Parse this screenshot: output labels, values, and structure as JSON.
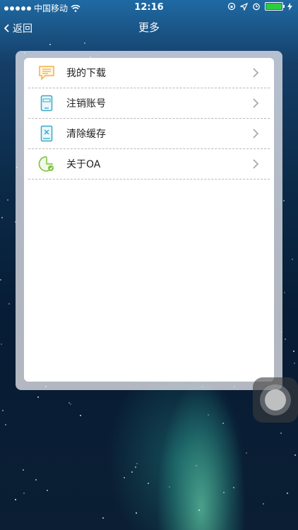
{
  "status_bar": {
    "carrier": "中国移动",
    "time": "12:16"
  },
  "nav": {
    "back_label": "返回",
    "title": "更多"
  },
  "menu": {
    "items": [
      {
        "label": "我的下载",
        "icon": "download-message-icon"
      },
      {
        "label": "注销账号",
        "icon": "phone-logout-icon"
      },
      {
        "label": "清除缓存",
        "icon": "clear-cache-icon"
      },
      {
        "label": "关于OA",
        "icon": "about-oa-icon"
      }
    ]
  },
  "colors": {
    "nav_blue": "#1f6aa4",
    "icon_orange": "#f0b24a",
    "icon_teal": "#3aa8c8",
    "icon_green": "#7fc241"
  }
}
